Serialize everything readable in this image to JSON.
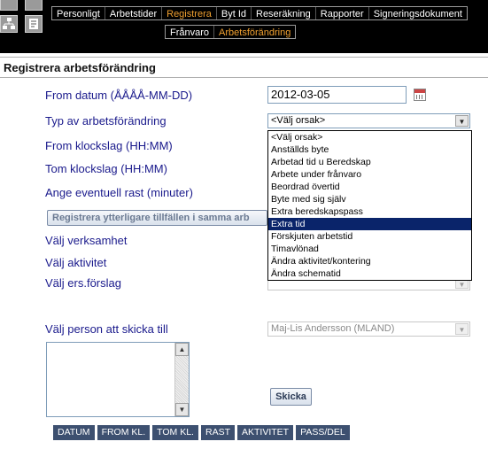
{
  "nav": {
    "main_tabs": [
      {
        "label": "Personligt"
      },
      {
        "label": "Arbetstider"
      },
      {
        "label": "Registrera",
        "active": true
      },
      {
        "label": "Byt Id"
      },
      {
        "label": "Reseräkning"
      },
      {
        "label": "Rapporter"
      },
      {
        "label": "Signeringsdokument"
      }
    ],
    "sub_tabs": [
      {
        "label": "Frånvaro"
      },
      {
        "label": "Arbetsförändring",
        "active": true
      }
    ],
    "active_color": "#f0a030"
  },
  "page_title": "Registrera arbetsförändring",
  "form": {
    "from_date_label": "From datum (ÅÅÅÅ-MM-DD)",
    "from_date_value": "2012-03-05",
    "type_label": "Typ av arbetsförändring",
    "type_selected": "<Välj orsak>",
    "type_options": [
      "<Välj orsak>",
      "Anställds byte",
      "Arbetad tid u Beredskap",
      "Arbete under frånvaro",
      "Beordrad övertid",
      "Byte med sig själv",
      "Extra beredskapspass",
      "Extra tid",
      "Förskjuten arbetstid",
      "Timavlönad",
      "Ändra aktivitet/kontering",
      "Ändra schematid"
    ],
    "type_highlighted": "Extra tid",
    "from_time_label": "From klockslag (HH:MM)",
    "to_time_label": "Tom klockslag (HH:MM)",
    "break_label": "Ange eventuell rast (minuter)",
    "register_more_button": "Registrera ytterligare tillfällen i samma arb",
    "business_label": "Välj verksamhet",
    "activity_label": "Välj aktivitet",
    "replacement_label": "Välj ers.förslag",
    "send_to_label": "Välj person att skicka till",
    "send_to_value": "Maj-Lis Andersson (MLAND)",
    "send_button": "Skicka"
  },
  "columns": [
    "DATUM",
    "FROM KL.",
    "TOM KL.",
    "RAST",
    "AKTIVITET",
    "PASS/DEL"
  ],
  "colors": {
    "label_color": "#1a1a8c",
    "header_bg": "#000000",
    "column_header_bg": "#3d5070"
  }
}
